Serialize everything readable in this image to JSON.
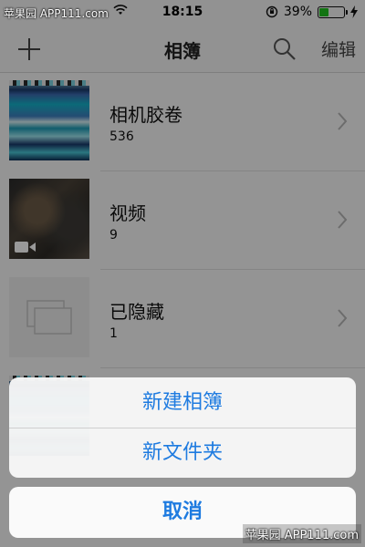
{
  "watermark": {
    "top": "苹果园 APP111.com",
    "bottom": "苹果园 APP111.com"
  },
  "status_bar": {
    "time": "18:15",
    "battery_percent": "39%",
    "battery_level": 0.39
  },
  "nav": {
    "title": "相簿",
    "edit_label": "编辑",
    "add_icon": "plus-icon",
    "search_icon": "search-icon"
  },
  "albums": [
    {
      "name": "相机胶卷",
      "count": "536"
    },
    {
      "name": "视频",
      "count": "9"
    },
    {
      "name": "已隐藏",
      "count": "1"
    }
  ],
  "action_sheet": {
    "new_album": "新建相簿",
    "new_folder": "新文件夹",
    "cancel": "取消"
  },
  "colors": {
    "accent": "#1e7be0",
    "battery_green": "#1fc21f"
  }
}
